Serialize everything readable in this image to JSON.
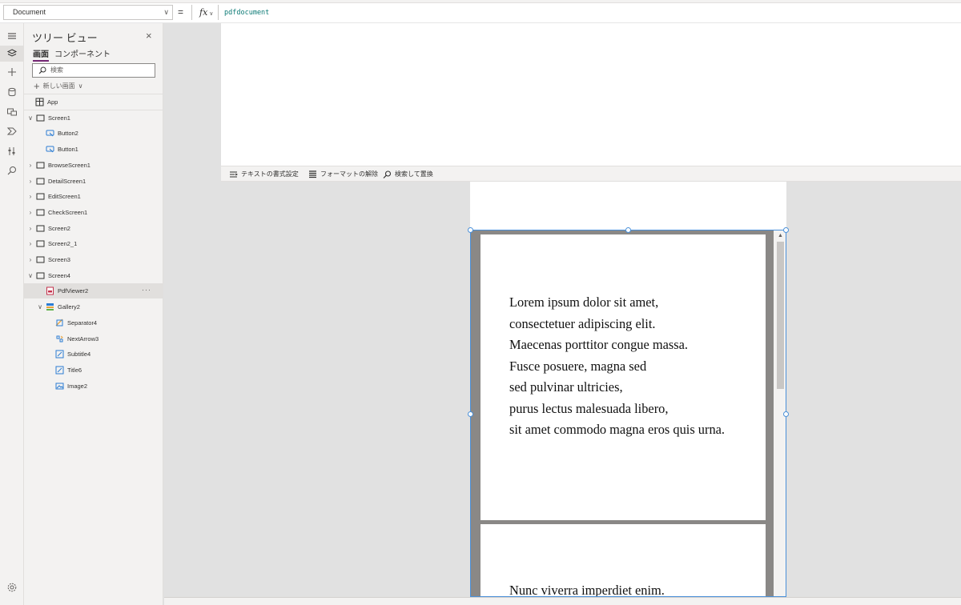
{
  "formula_bar": {
    "property": "Document",
    "equals": "=",
    "fx_label": "fx",
    "formula": "pdfdocument"
  },
  "formula_toolbar": {
    "format_text": "テキストの書式設定",
    "remove_format": "フォーマットの解除",
    "find_replace": "検索して置換"
  },
  "tree_view": {
    "title": "ツリー ビュー",
    "close": "×",
    "tabs": [
      "画面",
      "コンポーネント"
    ],
    "search_placeholder": "検索",
    "new_screen": "新しい画面",
    "nodes": [
      {
        "label": "App",
        "icon": "app-icon",
        "expand": ""
      },
      {
        "label": "Screen1",
        "icon": "screen-icon",
        "expand": "v"
      },
      {
        "label": "Button2",
        "icon": "button-icon",
        "expand": ""
      },
      {
        "label": "Button1",
        "icon": "button-icon",
        "expand": ""
      },
      {
        "label": "BrowseScreen1",
        "icon": "screen-icon",
        "expand": ">"
      },
      {
        "label": "DetailScreen1",
        "icon": "screen-icon",
        "expand": ">"
      },
      {
        "label": "EditScreen1",
        "icon": "screen-icon",
        "expand": ">"
      },
      {
        "label": "CheckScreen1",
        "icon": "screen-icon",
        "expand": ">"
      },
      {
        "label": "Screen2",
        "icon": "screen-icon",
        "expand": ">"
      },
      {
        "label": "Screen2_1",
        "icon": "screen-icon",
        "expand": ">"
      },
      {
        "label": "Screen3",
        "icon": "screen-icon",
        "expand": ">"
      },
      {
        "label": "Screen4",
        "icon": "screen-icon",
        "expand": "v"
      },
      {
        "label": "PdfViewer2",
        "icon": "pdf-icon",
        "expand": "",
        "selected": true,
        "more": "···"
      },
      {
        "label": "Gallery2",
        "icon": "gallery-icon",
        "expand": "v"
      },
      {
        "label": "Separator4",
        "icon": "separator-icon",
        "expand": ""
      },
      {
        "label": "NextArrow3",
        "icon": "arrow-icon",
        "expand": ""
      },
      {
        "label": "Subtitle4",
        "icon": "label-icon",
        "expand": ""
      },
      {
        "label": "Title6",
        "icon": "label-icon",
        "expand": ""
      },
      {
        "label": "Image2",
        "icon": "image-icon",
        "expand": ""
      }
    ]
  },
  "pdf": {
    "page1_lines": [
      "Lorem ipsum dolor sit amet,",
      "consectetuer adipiscing elit.",
      "Maecenas porttitor congue massa.",
      "Fusce posuere, magna sed",
      "sed pulvinar ultricies,",
      "purus lectus malesuada libero,",
      "sit amet commodo magna eros quis urna."
    ],
    "page2_lines": [
      "Nunc viverra imperdiet enim."
    ]
  },
  "colors": {
    "accent": "#742774",
    "selection_border": "#4a90d9",
    "formula_text": "#0b7a75"
  }
}
